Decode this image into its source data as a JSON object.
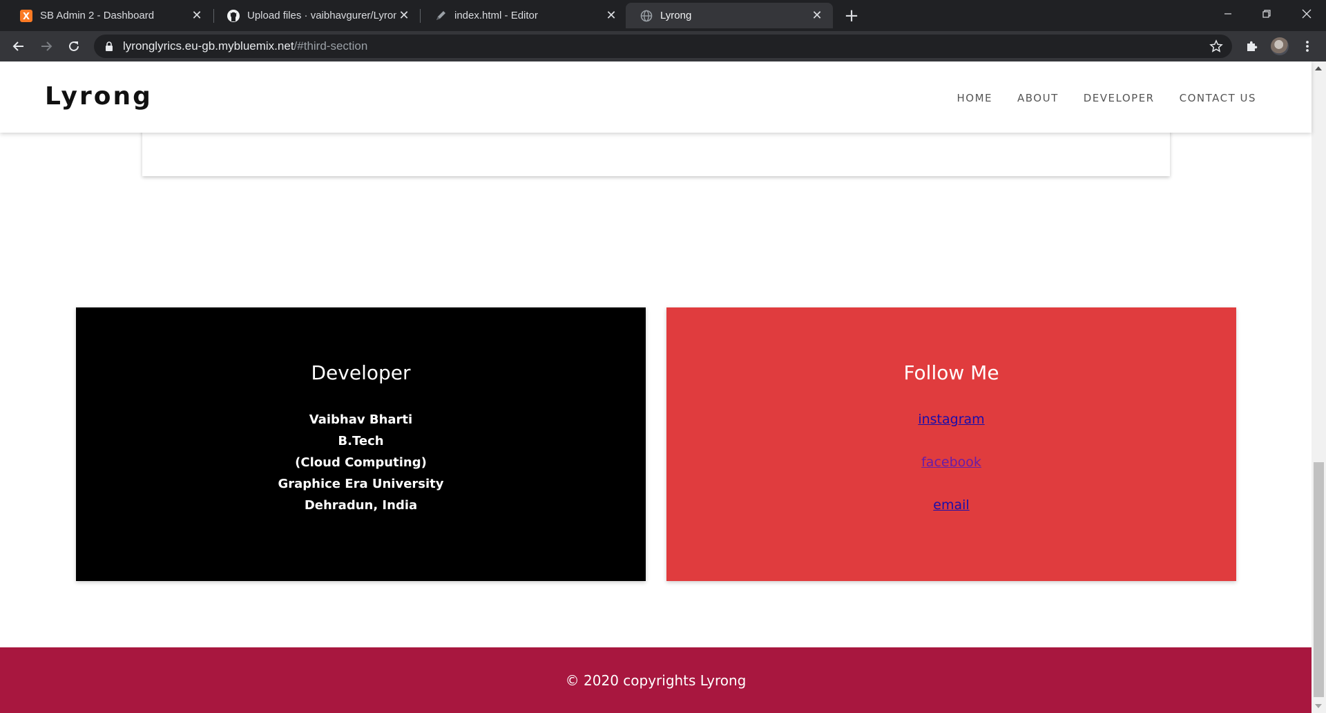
{
  "browser": {
    "tabs": [
      {
        "title": "SB Admin 2 - Dashboard",
        "icon": "xampp-icon"
      },
      {
        "title": "Upload files · vaibhavgurer/Lyrong",
        "icon": "github-icon"
      },
      {
        "title": "index.html - Editor",
        "icon": "pen-icon"
      },
      {
        "title": "Lyrong",
        "icon": "globe-icon"
      }
    ],
    "active_tab_index": 3,
    "url": {
      "host": "lyronglyrics.eu-gb.mybluemix.net",
      "path": "/#third-section"
    }
  },
  "site": {
    "logo": "Lyrong",
    "nav": [
      "HOME",
      "ABOUT",
      "DEVELOPER",
      "CONTACT US"
    ]
  },
  "developer": {
    "heading": "Developer",
    "lines": [
      "Vaibhav Bharti",
      "B.Tech",
      "(Cloud Computing)",
      "Graphice Era University",
      "Dehradun, India"
    ]
  },
  "follow": {
    "heading": "Follow Me",
    "links": [
      {
        "label": "instagram",
        "state": "unvisited"
      },
      {
        "label": "facebook",
        "state": "visited"
      },
      {
        "label": "email",
        "state": "unvisited"
      }
    ]
  },
  "footer": {
    "text": "© 2020 copyrights Lyrong"
  },
  "colors": {
    "chrome_dark": "#202124",
    "chrome_toolbar": "#35363a",
    "developer_box": "#000000",
    "follow_box": "#e03c3e",
    "footer": "#a8173f"
  }
}
